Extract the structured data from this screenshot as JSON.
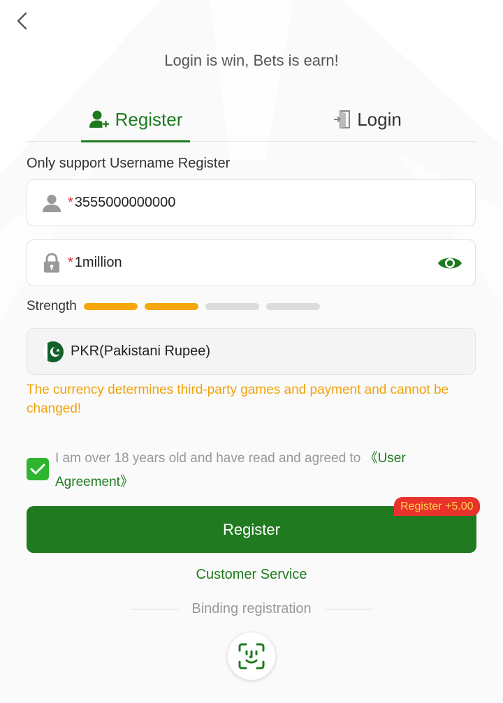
{
  "header": {
    "back_icon": "chevron-left-icon",
    "slogan": "Login is win, Bets is earn!"
  },
  "tabs": [
    {
      "label": "Register",
      "icon": "user-plus-icon",
      "active": true
    },
    {
      "label": "Login",
      "icon": "login-door-icon",
      "active": false
    }
  ],
  "form": {
    "hint": "Only support Username Register",
    "username": {
      "required_mark": "*",
      "value": "3555000000000",
      "icon": "user-icon"
    },
    "password": {
      "required_mark": "*",
      "value": "1million",
      "icon": "lock-icon",
      "toggle_icon": "eye-icon"
    },
    "strength": {
      "label": "Strength",
      "level": 2,
      "max": 4
    },
    "currency": {
      "value": "PKR(Pakistani Rupee)",
      "icon": "pakistan-flag-icon"
    },
    "currency_warning": "The currency determines third-party games and payment and cannot be changed!",
    "agreement": {
      "checked": true,
      "text": "I am over 18 years old and have read and agreed to ",
      "link": "《User Agreement》"
    }
  },
  "actions": {
    "register_label": "Register",
    "bonus_badge": "Register +5.00",
    "customer_service": "Customer Service",
    "binding_label": "Binding registration",
    "face_icon": "face-scan-icon"
  },
  "colors": {
    "brand_green": "#207a20",
    "warning_orange": "#f0a20a",
    "strength_on": "#f5a70c",
    "badge_red": "#e8322b"
  }
}
